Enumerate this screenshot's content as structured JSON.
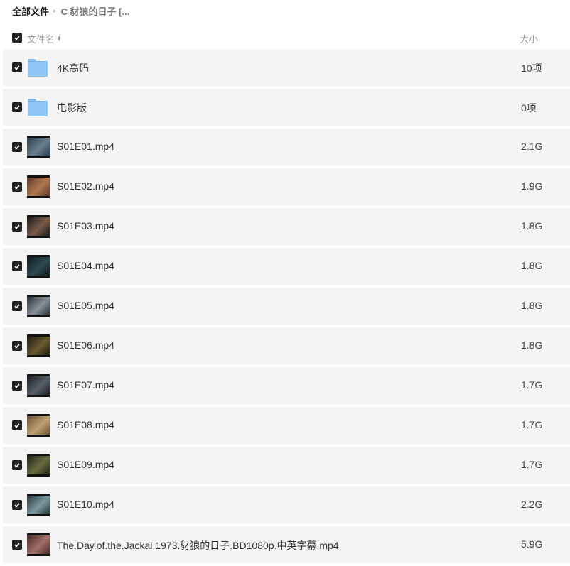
{
  "breadcrumb": {
    "root": "全部文件",
    "separator": "▸",
    "current": "C 豺狼的日子 [..."
  },
  "header": {
    "name_label": "文件名",
    "size_label": "大小"
  },
  "rows": [
    {
      "type": "folder",
      "name": "4K高码",
      "size": "10项"
    },
    {
      "type": "folder",
      "name": "电影版",
      "size": "0项"
    },
    {
      "type": "video",
      "name": "S01E01.mp4",
      "size": "2.1G",
      "thumb_colors": [
        "#2a3a45",
        "#6a8090"
      ]
    },
    {
      "type": "video",
      "name": "S01E02.mp4",
      "size": "1.9G",
      "thumb_colors": [
        "#5a3a28",
        "#b07850"
      ]
    },
    {
      "type": "video",
      "name": "S01E03.mp4",
      "size": "1.8G",
      "thumb_colors": [
        "#1a1a1a",
        "#7a5a48"
      ]
    },
    {
      "type": "video",
      "name": "S01E04.mp4",
      "size": "1.8G",
      "thumb_colors": [
        "#0e1a1e",
        "#2e4a50"
      ]
    },
    {
      "type": "video",
      "name": "S01E05.mp4",
      "size": "1.8G",
      "thumb_colors": [
        "#2a3038",
        "#8a9098"
      ]
    },
    {
      "type": "video",
      "name": "S01E06.mp4",
      "size": "1.8G",
      "thumb_colors": [
        "#1e1a12",
        "#6a5a30"
      ]
    },
    {
      "type": "video",
      "name": "S01E07.mp4",
      "size": "1.7G",
      "thumb_colors": [
        "#1a1e22",
        "#5a6068"
      ]
    },
    {
      "type": "video",
      "name": "S01E08.mp4",
      "size": "1.7G",
      "thumb_colors": [
        "#6a5038",
        "#c0a070"
      ]
    },
    {
      "type": "video",
      "name": "S01E09.mp4",
      "size": "1.7G",
      "thumb_colors": [
        "#1e2418",
        "#6a6a40"
      ]
    },
    {
      "type": "video",
      "name": "S01E10.mp4",
      "size": "2.2G",
      "thumb_colors": [
        "#28343a",
        "#7a9aa0"
      ]
    },
    {
      "type": "video",
      "name": "The.Day.of.the.Jackal.1973.豺狼的日子.BD1080p.中英字幕.mp4",
      "size": "5.9G",
      "thumb_colors": [
        "#4a2a28",
        "#a07068"
      ]
    }
  ],
  "colors": {
    "row_bg": "#f4f4f4",
    "checkbox": "#222222",
    "folder": "#8ec6f5"
  },
  "icons": {
    "checkbox": "checkbox-checked-icon",
    "folder": "folder-icon",
    "sort": "sort-icon"
  }
}
